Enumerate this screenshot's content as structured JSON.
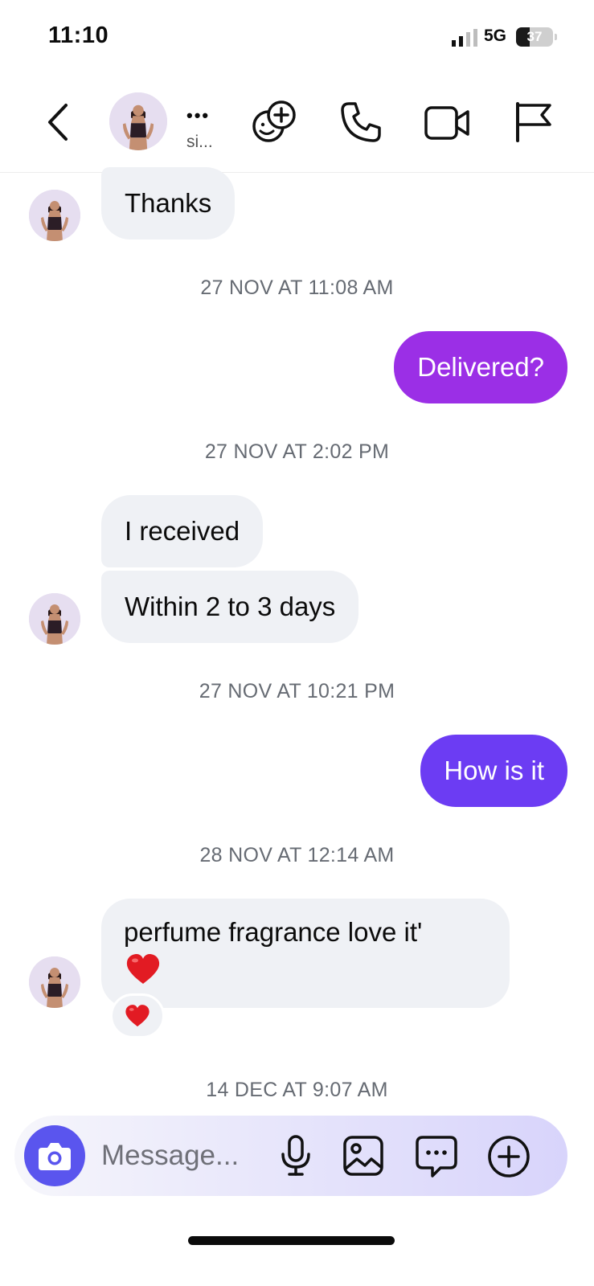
{
  "status_bar": {
    "time": "11:10",
    "network": "5G",
    "battery": "37",
    "battery_level": 0.37
  },
  "header": {
    "contact_name": "•••",
    "contact_sub": "si...",
    "icons": [
      "back-chevron-icon",
      "add-effect-icon",
      "phone-icon",
      "video-call-icon",
      "flag-icon"
    ]
  },
  "thread": [
    {
      "kind": "message",
      "direction": "in",
      "text": "Thanks"
    },
    {
      "kind": "timestamp",
      "text": "27 NOV AT 11:08 AM"
    },
    {
      "kind": "message",
      "direction": "out",
      "text": "Delivered?"
    },
    {
      "kind": "timestamp",
      "text": "27 NOV AT 2:02 PM"
    },
    {
      "kind": "message",
      "direction": "in",
      "text": "I received"
    },
    {
      "kind": "message",
      "direction": "in",
      "text": "Within 2 to 3 days"
    },
    {
      "kind": "timestamp",
      "text": "27 NOV AT 10:21 PM"
    },
    {
      "kind": "message",
      "direction": "out",
      "text": "How is it"
    },
    {
      "kind": "timestamp",
      "text": "28 NOV AT 12:14 AM"
    },
    {
      "kind": "message",
      "direction": "in",
      "text": "perfume fragrance love it'",
      "emoji": "❤️",
      "reaction": "❤️"
    },
    {
      "kind": "timestamp",
      "text": "14 DEC AT 9:07 AM"
    }
  ],
  "composer": {
    "placeholder": "Message...",
    "icons": [
      "camera-icon",
      "microphone-icon",
      "gallery-icon",
      "sticker-icon",
      "add-icon"
    ]
  },
  "colors": {
    "outgoing_1": "#9b2fe6",
    "outgoing_2": "#6c3cf3",
    "incoming": "#eff1f5",
    "camera_button": "#5a55ee"
  }
}
